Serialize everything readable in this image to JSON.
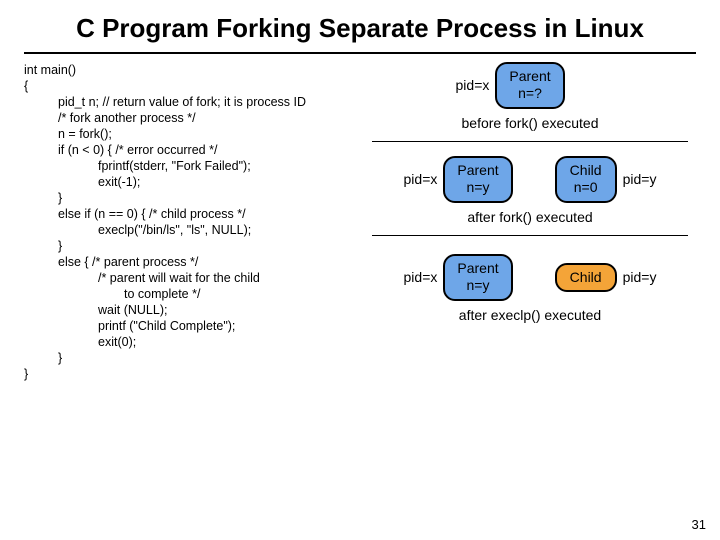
{
  "title": "C Program Forking Separate Process in Linux",
  "code": {
    "l00": "int main()",
    "l01": "{",
    "l02": "pid_t  n; // return value of fork; it is process ID",
    "l03": "/* fork another process */",
    "l04": "n = fork();",
    "l05": "if (n < 0) { /* error occurred */",
    "l06": "fprintf(stderr, \"Fork Failed\");",
    "l07": "exit(-1);",
    "l08": "}",
    "l09": "else if (n == 0) { /* child process */",
    "l10": "execlp(\"/bin/ls\", \"ls\", NULL);",
    "l11": "}",
    "l12": "else { /* parent process */",
    "l13": "/* parent will wait for the child",
    "l14": "to complete */",
    "l15": "wait (NULL);",
    "l16": "printf (\"Child Complete\");",
    "l17": "exit(0);",
    "l18": "}",
    "l19": "}"
  },
  "diagram": {
    "stage1": {
      "pid_left": "pid=x",
      "box": {
        "line1": "Parent",
        "line2": "n=?"
      },
      "caption": "before fork() executed"
    },
    "stage2": {
      "pid_left": "pid=x",
      "boxL": {
        "line1": "Parent",
        "line2": "n=y"
      },
      "boxR": {
        "line1": "Child",
        "line2": "n=0"
      },
      "pid_right": "pid=y",
      "caption": "after fork() executed"
    },
    "stage3": {
      "pid_left": "pid=x",
      "boxL": {
        "line1": "Parent",
        "line2": "n=y"
      },
      "boxR": {
        "line1": "Child"
      },
      "pid_right": "pid=y",
      "caption": "after execlp() executed"
    }
  },
  "slidenum": "31"
}
